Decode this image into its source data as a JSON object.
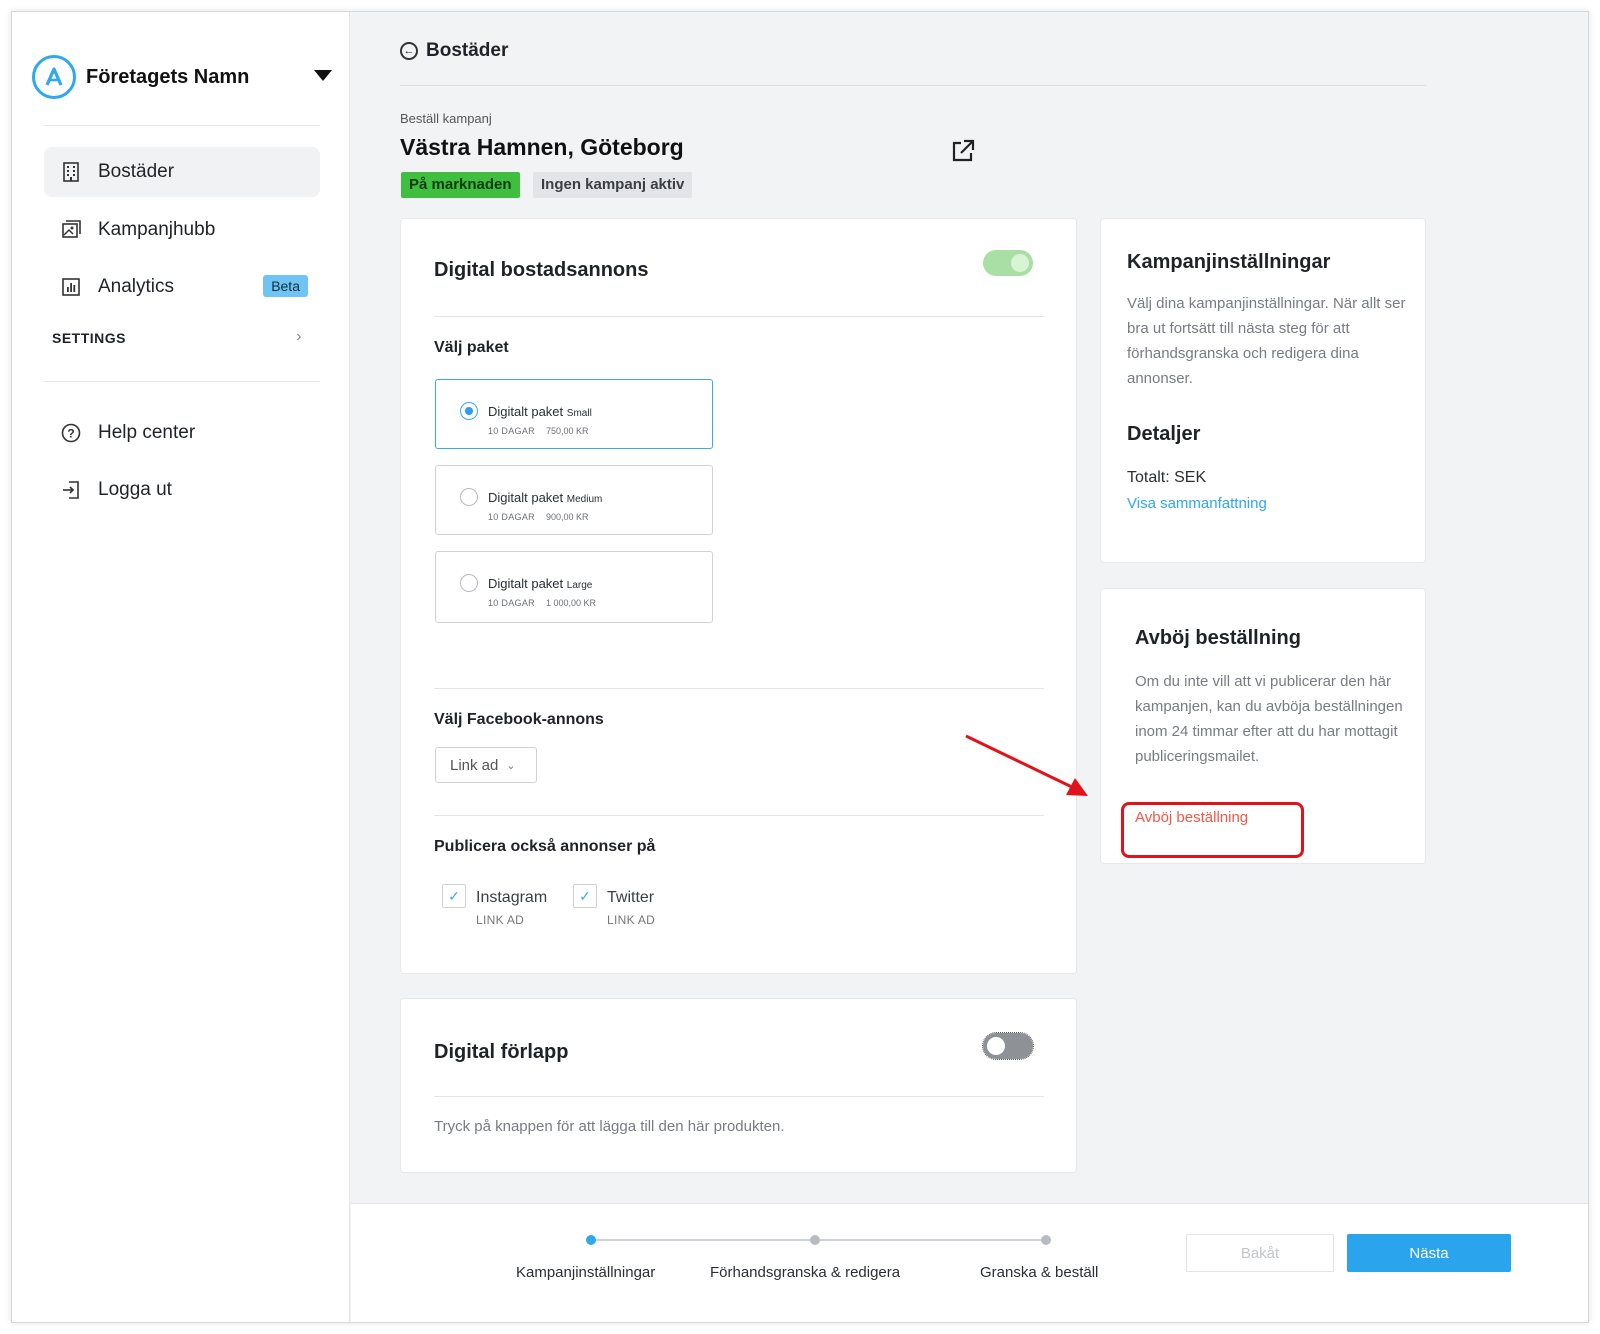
{
  "sidebar": {
    "company_name": "Företagets Namn",
    "items": [
      {
        "label": "Bostäder",
        "icon": "building-icon"
      },
      {
        "label": "Kampanjhubb",
        "icon": "image-gallery-icon"
      },
      {
        "label": "Analytics",
        "icon": "bar-chart-icon",
        "badge": "Beta"
      }
    ],
    "settings_label": "SETTINGS",
    "bottom_items": [
      {
        "label": "Help center",
        "icon": "help-circle-icon"
      },
      {
        "label": "Logga ut",
        "icon": "logout-icon"
      }
    ]
  },
  "header": {
    "back_label": "Bostäder"
  },
  "campaign": {
    "order_label": "Beställ kampanj",
    "title": "Västra Hamnen, Göteborg",
    "status_badges": [
      "På marknaden",
      "Ingen kampanj aktiv"
    ]
  },
  "digital_ad": {
    "title": "Digital bostadsannons",
    "toggle_on": true,
    "package_label": "Välj paket",
    "packages": [
      {
        "name": "Digitalt paket",
        "size": "Small",
        "days": "10 DAGAR",
        "price": "750,00 KR",
        "selected": true
      },
      {
        "name": "Digitalt paket",
        "size": "Medium",
        "days": "10 DAGAR",
        "price": "900,00 KR",
        "selected": false
      },
      {
        "name": "Digitalt paket",
        "size": "Large",
        "days": "10 DAGAR",
        "price": "1 000,00 KR",
        "selected": false
      }
    ],
    "facebook_label": "Välj Facebook-annons",
    "facebook_value": "Link ad",
    "also_publish_label": "Publicera också annonser på",
    "channels": [
      {
        "name": "Instagram",
        "type": "LINK AD",
        "checked": true
      },
      {
        "name": "Twitter",
        "type": "LINK AD",
        "checked": true
      }
    ]
  },
  "preroll": {
    "title": "Digital förlapp",
    "toggle_on": false,
    "description": "Tryck på knappen för att lägga till den här produkten."
  },
  "settings_card": {
    "title": "Kampanjinställningar",
    "description": "Välj dina kampanjinställningar. När allt ser bra ut fortsätt till nästa steg för att förhandsgranska och redigera dina annonser.",
    "details_title": "Detaljer",
    "total": "Totalt: SEK",
    "summary_link": "Visa sammanfattning"
  },
  "decline_card": {
    "title": "Avböj beställning",
    "description": "Om du inte vill att vi publicerar den här kampanjen, kan du avböja beställningen inom 24 timmar efter att du har mottagit publiceringsmailet.",
    "link": "Avböj beställning"
  },
  "footer": {
    "steps": [
      "Kampanjinställningar",
      "Förhandsgranska & redigera",
      "Granska & beställ"
    ],
    "active_step": 0,
    "back_label": "Bakåt",
    "next_label": "Nästa"
  },
  "colors": {
    "accent": "#2aa4ec",
    "status_green": "#3fbe3f",
    "decline_red": "#f0584a",
    "annotation_red": "#e0131a"
  }
}
